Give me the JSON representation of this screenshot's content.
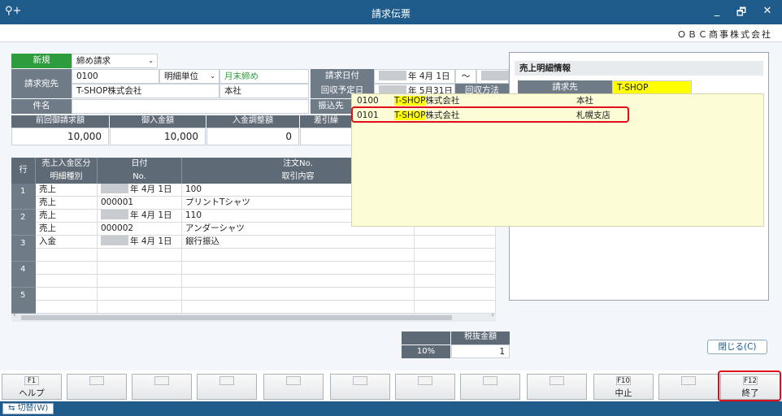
{
  "window": {
    "title": "請求伝票",
    "minimize": "_",
    "restore": "🗗",
    "close": "✕",
    "search_icon": "⚲+"
  },
  "company": "ＯＢＣ商事株式会社",
  "header": {
    "new_label": "新規",
    "billing_type": "締め請求",
    "billing_to_label": "請求宛先",
    "billing_to_code": "0100",
    "billing_to_name": "T-SHOP株式会社",
    "detail_unit_label": "明細単位",
    "closing": "月末締め",
    "branch": "本社",
    "subject_label": "件名",
    "invoice_date_label": "請求日付",
    "invoice_date": "年  4月  1日",
    "tilde": "〜",
    "collect_date_label": "回収予定日",
    "collect_date": "年  5月31日",
    "collect_method_label": "回収方法",
    "transfer_label": "振込先"
  },
  "summary": {
    "headers": [
      "前回御請求額",
      "御入金額",
      "入金調整額",
      "差引繰"
    ],
    "values": [
      "10,000",
      "10,000",
      "0"
    ]
  },
  "grid": {
    "row_label": "行",
    "headers_top": [
      "売上入金区分",
      "日付",
      "注文No."
    ],
    "headers_bottom": [
      "明細種別",
      "No.",
      "取引内容"
    ],
    "rows": [
      {
        "num": "1",
        "kind": "売上",
        "date": "年  4月  1日",
        "order": "100",
        "type": "売上",
        "no": "000001",
        "desc": "プリントTシャツ"
      },
      {
        "num": "2",
        "kind": "売上",
        "date": "年  4月  1日",
        "order": "110",
        "type": "売上",
        "no": "000002",
        "desc": "アンダーシャツ"
      },
      {
        "num": "3",
        "kind": "入金",
        "date": "年  4月  1日",
        "order": "銀行振込",
        "type": "",
        "no": "",
        "desc": ""
      },
      {
        "num": "4",
        "kind": "",
        "date": "",
        "order": "",
        "type": "",
        "no": "",
        "desc": ""
      },
      {
        "num": "5",
        "kind": "",
        "date": "",
        "order": "",
        "type": "",
        "no": "",
        "desc": ""
      }
    ]
  },
  "tax": {
    "header": "税抜金額",
    "rate": "10%",
    "value": "1"
  },
  "panel": {
    "title": "売上明細情報",
    "billing_label": "請求先",
    "billing_value": "T-SHOP",
    "close_button": "閉じる(C)"
  },
  "dropdown": {
    "rows": [
      {
        "code": "0100",
        "name_highlight": "T-SHOP",
        "name_rest": "株式会社",
        "branch": "本社"
      },
      {
        "code": "0101",
        "name_highlight": "T-SHOP",
        "name_rest": "株式会社",
        "branch": "札幌支店"
      }
    ]
  },
  "fkeys": [
    {
      "code": "F1",
      "label": "ヘルプ"
    },
    {
      "code": "",
      "label": ""
    },
    {
      "code": "",
      "label": ""
    },
    {
      "code": "",
      "label": ""
    },
    {
      "code": "",
      "label": ""
    },
    {
      "code": "",
      "label": ""
    },
    {
      "code": "",
      "label": ""
    },
    {
      "code": "",
      "label": ""
    },
    {
      "code": "",
      "label": ""
    },
    {
      "code": "F10",
      "label": "中止"
    },
    {
      "code": "",
      "label": ""
    },
    {
      "code": "F12",
      "label": "終了"
    }
  ],
  "status": {
    "switch_label": "切替(W)"
  },
  "colors": {
    "titlebar": "#1e5a8a",
    "highlight": "#ffff00",
    "callout": "#e0101a"
  }
}
